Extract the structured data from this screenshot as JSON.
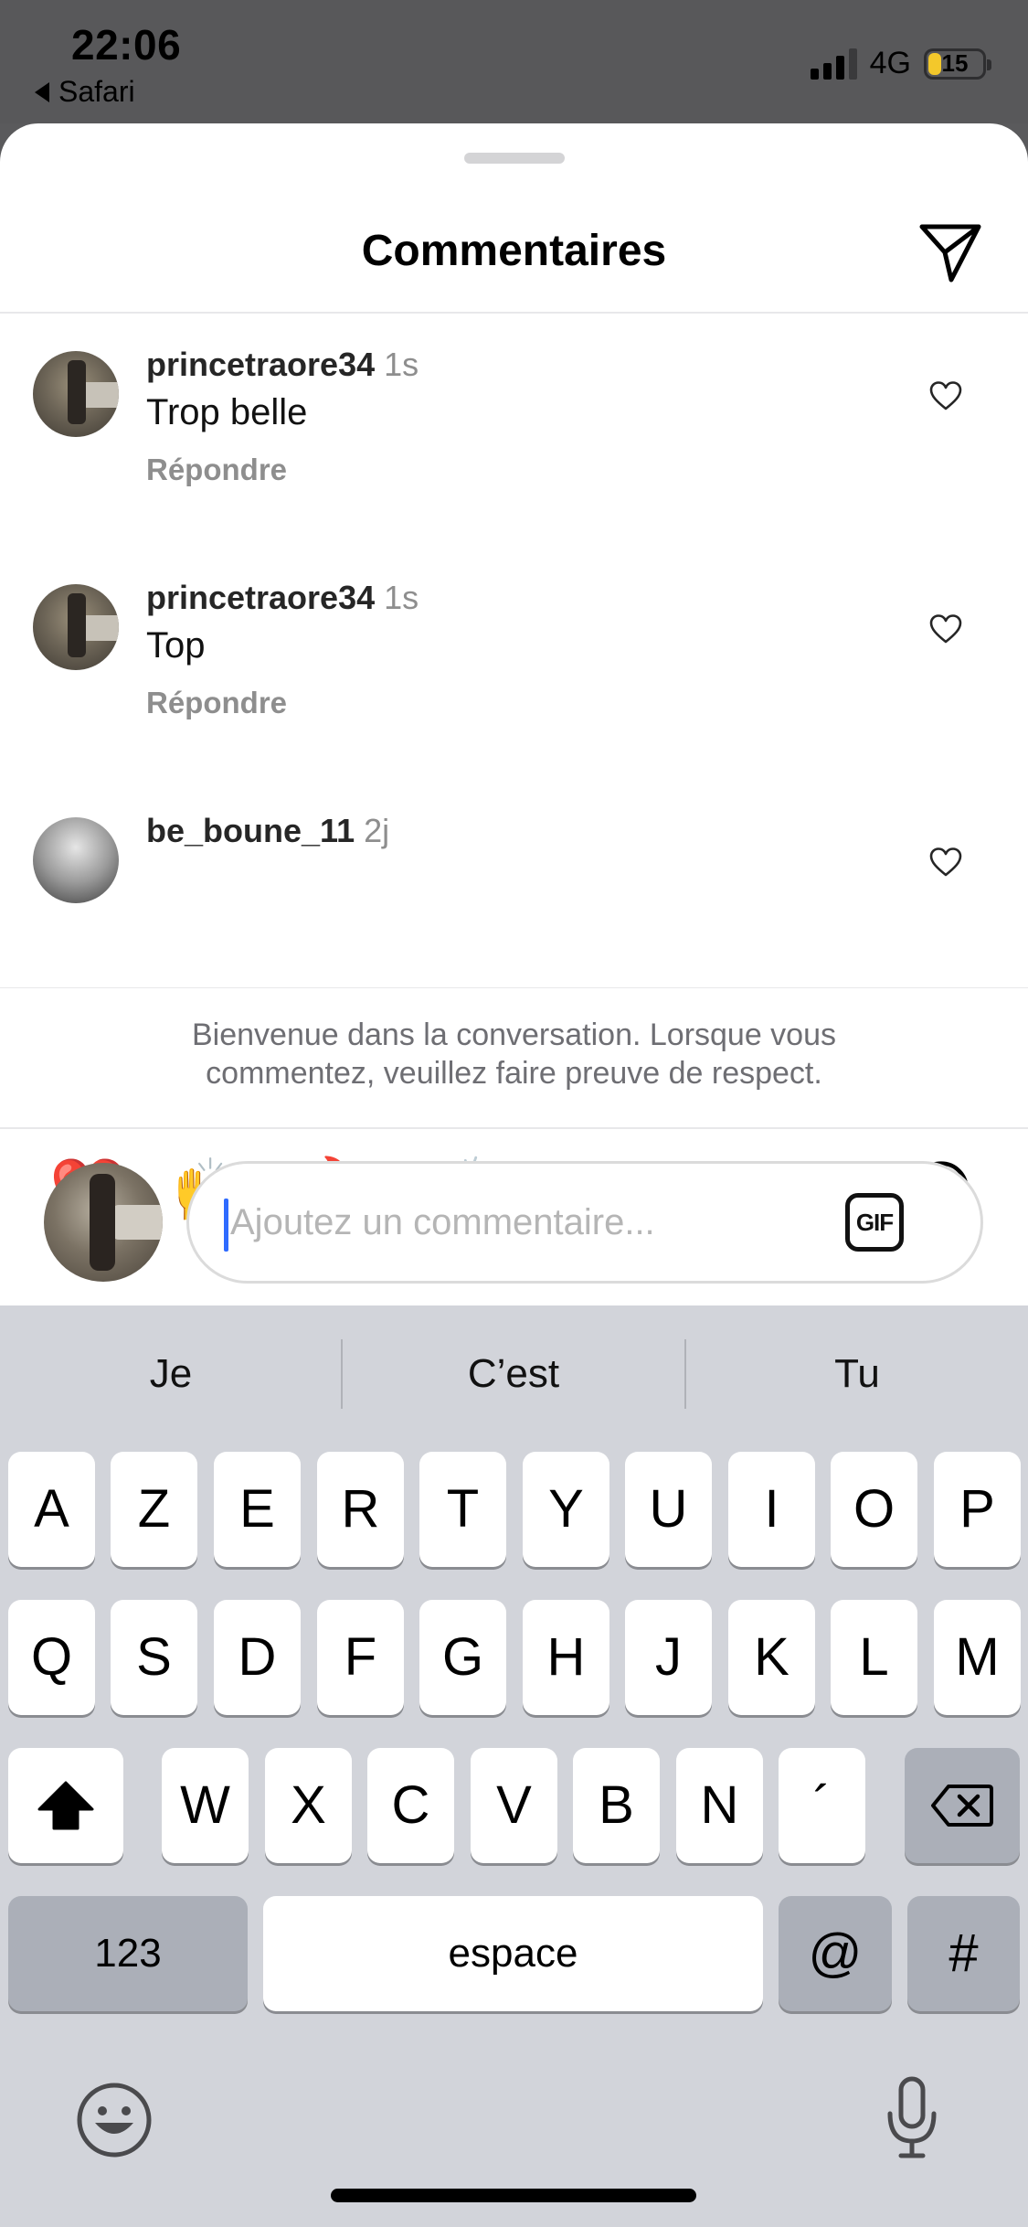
{
  "status_bar": {
    "time": "22:06",
    "back_app": "Safari",
    "network": "4G",
    "battery": "15",
    "battery_color": "#f3c82b"
  },
  "sheet": {
    "title": "Commentaires",
    "send_icon": "paper-plane-icon"
  },
  "comments": [
    {
      "username": "princetraore34",
      "time": "1s",
      "text": "Trop belle",
      "reply_label": "Répondre"
    },
    {
      "username": "princetraore34",
      "time": "1s",
      "text": "Top",
      "reply_label": "Répondre"
    },
    {
      "username": "be_boune_11",
      "time": "2j"
    }
  ],
  "welcome": {
    "line1": "Bienvenue dans la conversation. Lorsque vous",
    "line2": "commentez, veuillez faire preuve de respect."
  },
  "quick_emojis": [
    "❤️",
    "🙌",
    "🔥",
    "👏",
    "😢",
    "😍",
    "😮",
    "😂"
  ],
  "composer": {
    "placeholder": "Ajoutez un commentaire...",
    "gif_label": "GIF",
    "caret_color": "#2f6bff"
  },
  "keyboard": {
    "suggestions": [
      "Je",
      "C’est",
      "Tu"
    ],
    "row1": [
      "A",
      "Z",
      "E",
      "R",
      "T",
      "Y",
      "U",
      "I",
      "O",
      "P"
    ],
    "row2": [
      "Q",
      "S",
      "D",
      "F",
      "G",
      "H",
      "J",
      "K",
      "L",
      "M"
    ],
    "row3": [
      "W",
      "X",
      "C",
      "V",
      "B",
      "N",
      "´"
    ],
    "numbers_label": "123",
    "space_label": "espace",
    "at_label": "@",
    "hash_label": "#"
  }
}
